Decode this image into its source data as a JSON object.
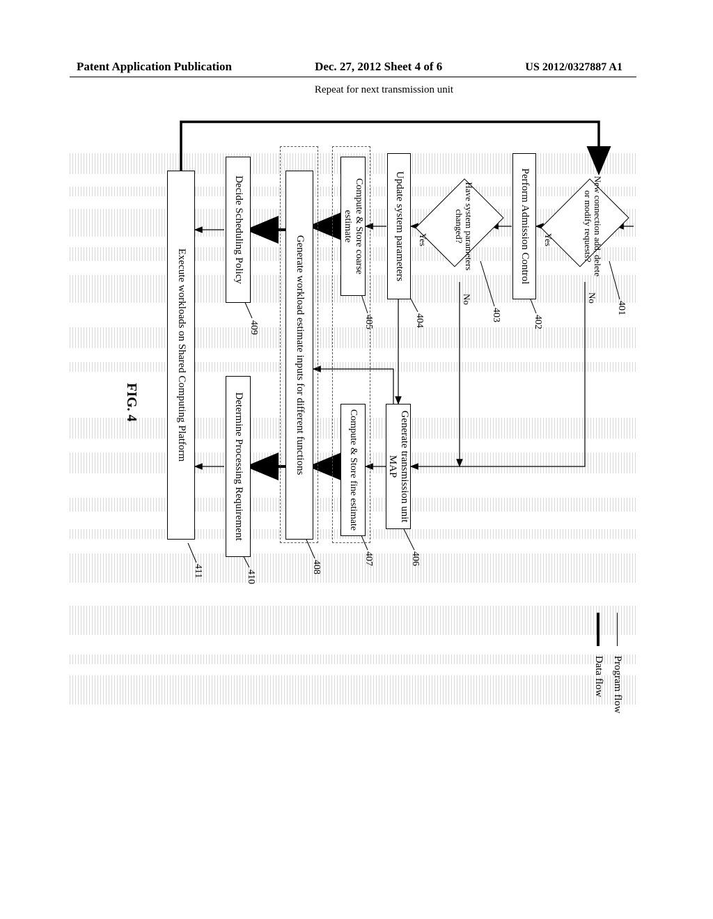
{
  "header": {
    "left": "Patent Application Publication",
    "middle": "Dec. 27, 2012  Sheet 4 of 6",
    "right": "US 2012/0327887 A1"
  },
  "figure_caption": "FIG. 4",
  "legend": {
    "program_flow": "Program flow",
    "data_flow": "Data flow"
  },
  "loop_label": "Repeat for next transmission unit",
  "branches": {
    "yes": "Yes",
    "no": "No"
  },
  "nodes": {
    "n401": {
      "ref": "401",
      "text": "New connection add, delete or modify requests?"
    },
    "n402": {
      "ref": "402",
      "text": "Perform Admission Control"
    },
    "n403": {
      "ref": "403",
      "text": "Have system parameters changed?"
    },
    "n404": {
      "ref": "404",
      "text": "Update system parameters"
    },
    "n405": {
      "ref": "405",
      "text": "Compute & Store coarse estimate"
    },
    "n406": {
      "ref": "406",
      "text": "Generate transmission unit MAP"
    },
    "n407": {
      "ref": "407",
      "text": "Compute & Store fine estimate"
    },
    "n408": {
      "ref": "408",
      "text": "Generate workload estimate inputs for different functions"
    },
    "n409": {
      "ref": "409",
      "text": "Decide Scheduling Policy"
    },
    "n410": {
      "ref": "410",
      "text": "Determine Processing Requirement"
    },
    "n411": {
      "ref": "411",
      "text": "Execute workloads on Shared Computing Platform"
    }
  },
  "chart_data": {
    "type": "flowchart",
    "nodes": [
      {
        "id": "401",
        "type": "decision",
        "text": "New connection add, delete or modify requests?"
      },
      {
        "id": "402",
        "type": "process",
        "text": "Perform Admission Control"
      },
      {
        "id": "403",
        "type": "decision",
        "text": "Have system parameters changed?"
      },
      {
        "id": "404",
        "type": "process",
        "text": "Update system parameters"
      },
      {
        "id": "405",
        "type": "process",
        "text": "Compute & Store coarse estimate"
      },
      {
        "id": "406",
        "type": "process",
        "text": "Generate transmission unit MAP"
      },
      {
        "id": "407",
        "type": "process",
        "text": "Compute & Store fine estimate"
      },
      {
        "id": "408",
        "type": "process",
        "text": "Generate workload estimate inputs for different functions"
      },
      {
        "id": "409",
        "type": "process",
        "text": "Decide Scheduling Policy"
      },
      {
        "id": "410",
        "type": "process",
        "text": "Determine Processing Requirement"
      },
      {
        "id": "411",
        "type": "process",
        "text": "Execute workloads on Shared Computing Platform"
      }
    ],
    "edges": [
      {
        "from": "start",
        "to": "401",
        "type": "program"
      },
      {
        "from": "401",
        "to": "402",
        "label": "Yes",
        "type": "program"
      },
      {
        "from": "401",
        "to": "406",
        "label": "No",
        "type": "program"
      },
      {
        "from": "402",
        "to": "403",
        "type": "program"
      },
      {
        "from": "403",
        "to": "404",
        "label": "Yes",
        "type": "program"
      },
      {
        "from": "403",
        "to": "406",
        "label": "No",
        "type": "program"
      },
      {
        "from": "404",
        "to": "405",
        "type": "program"
      },
      {
        "from": "404",
        "to": "406",
        "type": "program"
      },
      {
        "from": "406",
        "to": "407",
        "type": "program"
      },
      {
        "from": "406",
        "to": "408",
        "type": "program"
      },
      {
        "from": "405",
        "to": "408",
        "type": "data"
      },
      {
        "from": "407",
        "to": "408",
        "type": "data"
      },
      {
        "from": "408",
        "to": "409",
        "type": "data"
      },
      {
        "from": "408",
        "to": "410",
        "type": "data"
      },
      {
        "from": "409",
        "to": "411",
        "type": "program"
      },
      {
        "from": "410",
        "to": "411",
        "type": "program"
      },
      {
        "from": "411",
        "to": "401",
        "label": "Repeat for next transmission unit",
        "type": "program"
      }
    ],
    "legend": {
      "thin_line": "Program flow",
      "thick_line": "Data flow"
    }
  }
}
